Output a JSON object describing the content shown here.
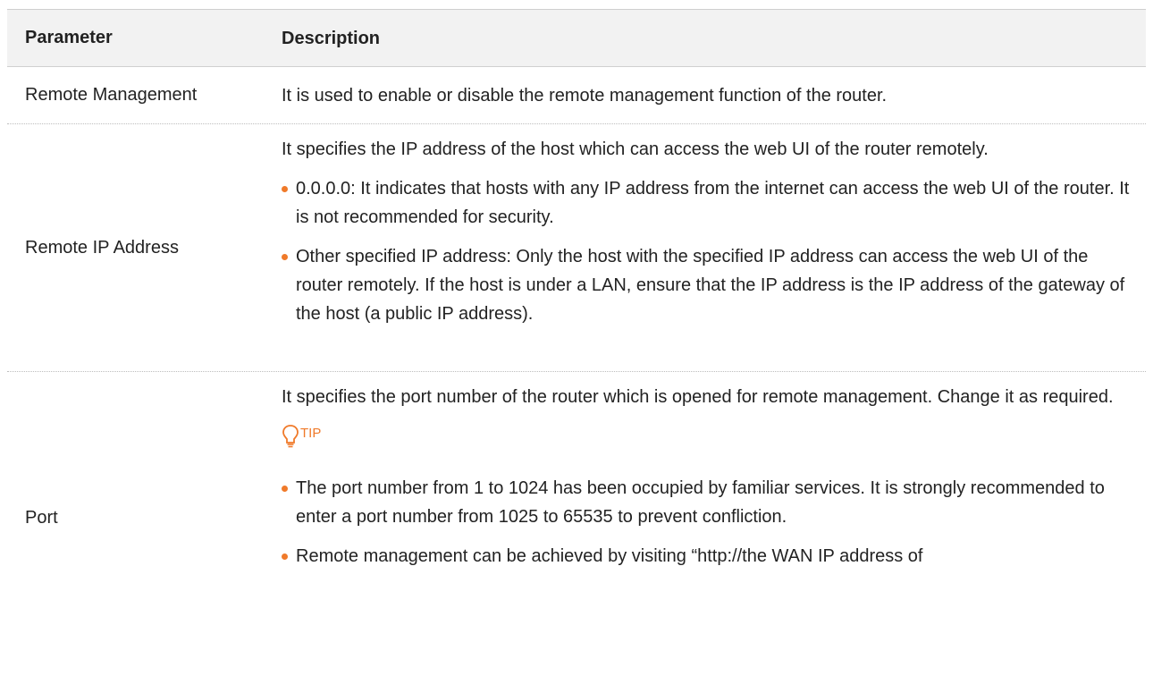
{
  "table": {
    "headers": [
      "Parameter",
      "Description"
    ],
    "rows": [
      {
        "parameter": "Remote Management",
        "description": "It is used to enable or disable the remote management function of the router."
      },
      {
        "parameter": "Remote IP Address",
        "intro": "It specifies the IP address of the host which can access the web UI of the router remotely.",
        "bullets": [
          "0.0.0.0: It indicates that hosts with any IP address from the internet can access the web UI of the router. It is not recommended for security.",
          "Other specified IP address: Only the host with the specified IP address can access the web UI of the router remotely. If the host is under a LAN, ensure that the IP address is the IP address of the gateway of the host (a public IP address)."
        ]
      },
      {
        "parameter": "Port",
        "intro": "It specifies the port number of the router which is opened for remote management. Change it as required.",
        "tip_label": "TIP",
        "tip_icon": "lightbulb-icon",
        "bullets": [
          "The port number from 1 to 1024 has been occupied by familiar services. It is strongly recommended to enter a port number from 1025 to 65535 to prevent confliction.",
          "Remote management can be achieved by visiting “http://the WAN IP address of"
        ]
      }
    ]
  },
  "colors": {
    "accent": "#f07a2a",
    "header_bg": "#f2f2f2"
  }
}
